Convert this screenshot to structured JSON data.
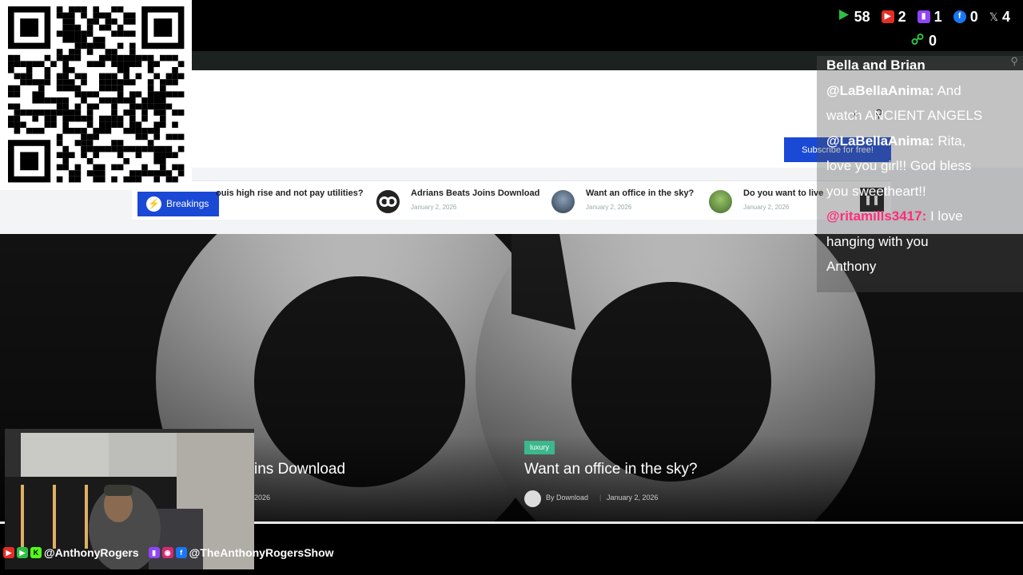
{
  "counters": {
    "rumble": "58",
    "youtube": "2",
    "twitch": "1",
    "facebook": "0",
    "x": "4",
    "link": "0"
  },
  "colors": {
    "brand_blue": "#1a49d6",
    "category_green": "#3bb88c",
    "rumble": "#2dbe43",
    "youtube": "#e52d27",
    "twitch": "#8f44f7",
    "facebook": "#1877f2",
    "chat_user": "#ff2d7a"
  },
  "site": {
    "subscribe_label": "Subscribe for free!",
    "breakings_label": "Breakings",
    "ticker": [
      {
        "title": "Adrians Beats Joins Download",
        "date": "January 2, 2026"
      },
      {
        "title": "Want an office in the sky?",
        "date": "January 2, 2026"
      },
      {
        "title": "Do you want to live",
        "date": "January 2, 2026"
      }
    ],
    "ticker_partial": "ouis high rise and not pay utilities?",
    "hero_left": {
      "title": "ins Download",
      "date": "2026"
    },
    "hero_right": {
      "category": "luxury",
      "title": "Want an office in the sky?",
      "author": "By Download",
      "date": "January 2, 2026"
    }
  },
  "chat": {
    "lines": [
      {
        "user": "Bella and Brian",
        "text": ""
      },
      {
        "user": "@LaBellaAnima:",
        "text": " And"
      },
      {
        "user": "",
        "text": "watch ANCIENT ANGELS"
      },
      {
        "user": "@LaBellaAnima:",
        "text": " Rita,"
      },
      {
        "user": "",
        "text": "love you girl!! God bless"
      },
      {
        "user": "",
        "text": "you sweetheart!!"
      },
      {
        "user": "@ritamills3417:",
        "text": " I love"
      },
      {
        "user": "",
        "text": "hanging with you"
      },
      {
        "user": "",
        "text": "Anthony"
      }
    ]
  },
  "socials": {
    "handle1": "@AnthonyRogers",
    "handle2": "@TheAnthonyRogersShow"
  }
}
